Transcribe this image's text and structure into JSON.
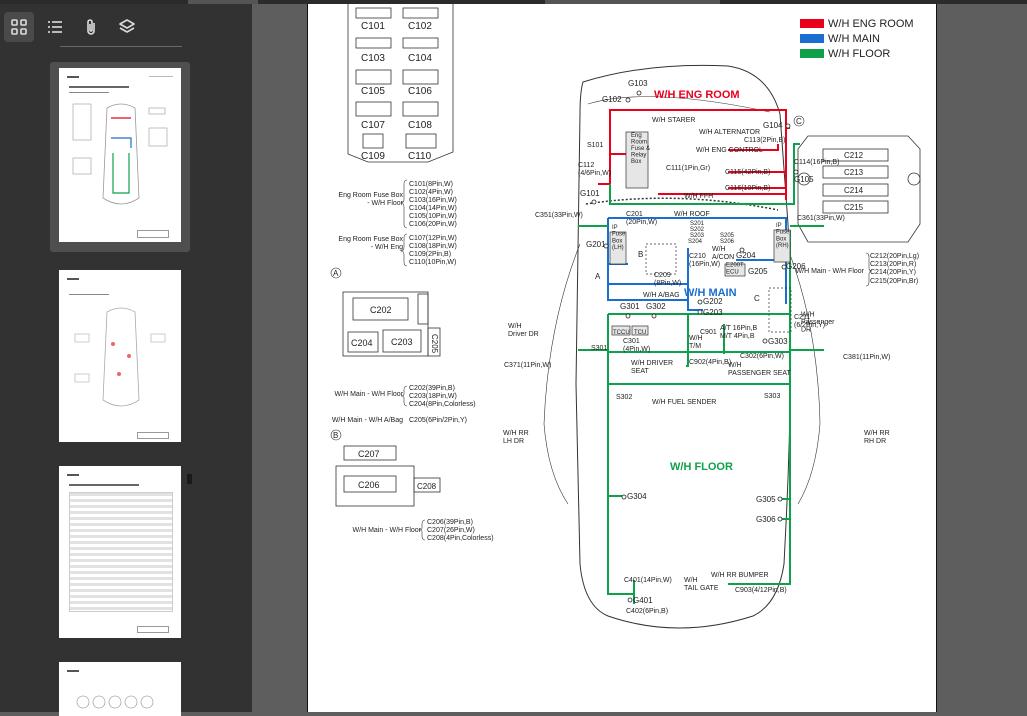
{
  "legend": [
    {
      "label": "W/H ENG ROOM",
      "color": "#e8001c"
    },
    {
      "label": "W/H MAIN",
      "color": "#1a6ecf"
    },
    {
      "label": "W/H FLOOR",
      "color": "#0fa14a"
    }
  ],
  "colors": {
    "eng": "#e8001c",
    "main": "#1a6ecf",
    "floor": "#0fa14a"
  },
  "sidebar": {
    "tools": [
      {
        "name": "thumbnails",
        "icon": "grid-icon"
      },
      {
        "name": "outline",
        "icon": "list-icon"
      },
      {
        "name": "attachments",
        "icon": "paperclip-icon"
      },
      {
        "name": "layers",
        "icon": "layers-icon"
      }
    ]
  },
  "diagram": {
    "zone_titles": {
      "eng": "W/H ENG ROOM",
      "main": "W/H MAIN",
      "floor": "W/H FLOOR"
    },
    "connector_box": [
      "C101",
      "C102",
      "C103",
      "C104",
      "C105",
      "C106",
      "C107",
      "C108",
      "C109",
      "C110"
    ],
    "fuse_box_eng_title": "Eng Room Fuse Box\n- W/H Floor",
    "fuse_box_eng_items": [
      "C101(8Pin,W)",
      "C102(4Pin,W)",
      "C103(16Pin,W)",
      "C104(14Pin,W)",
      "C105(10Pin,W)",
      "C106(20Pin,W)"
    ],
    "fuse_box_eng2_title": "Eng Room Fuse Box\n- W/H Eng",
    "fuse_box_eng2_items": [
      "C107(12Pin,W)",
      "C108(18Pin,W)",
      "C109(2Pin,B)",
      "C110(10Pin,W)"
    ],
    "detail_a": {
      "mark": "A",
      "c202": "C202",
      "c204": "C204",
      "c203": "C203",
      "c205": "C205"
    },
    "detail_b": {
      "mark": "B",
      "c207": "C207",
      "c206": "C206",
      "c208": "C208"
    },
    "detail_c": {
      "mark": "C",
      "c212": "C212",
      "c213": "C213",
      "c214": "C214",
      "c215": "C215"
    },
    "wh_main_floor_left": "W/H Main - W/H Floor",
    "left_a_items": [
      "C202(39Pin,B)",
      "C203(18Pin,W)",
      "C204(8Pin,Colorless)"
    ],
    "wh_main_abag": "W/H Main - W/H A/Bag",
    "c205_label": "C205(6Pin/2Pin,Y)",
    "wh_main_floor_b": "W/H Main - W/H Floor",
    "left_b_items": [
      "C206(39Pin,B)",
      "C207(26Pin,W)",
      "C208(4Pin,Colorless)"
    ],
    "right_c_title": "W/H Main - W/H Floor",
    "right_c_items": [
      "C212(20Pin,Lg)",
      "C213(20Pin,R)",
      "C214(20Pin,Y)",
      "C215(20Pin,Br)"
    ],
    "labels": {
      "g103": "G103",
      "g102": "G102",
      "ws": "W/H STARER",
      "s101": "S101",
      "erfb": "Eng\nRoom\nFuse &\nRelay\nBox",
      "c112": "C112\n(4/6Pin,W)",
      "c111": "C111(1Pin,Gr)",
      "g101": "G101",
      "g104": "G104",
      "wha": "W/H ALTERNATOR",
      "c113": "C113(2Pin,B)",
      "whec": "W/H ENG CONTROL",
      "c114": "C114(16Pin,B)",
      "c115": "C115(42Pin,B)",
      "g105": "G105",
      "c116": "C116(10Pin,B)",
      "whffh": "W/H FFH",
      "c351": "C351(33Pin,W)",
      "c201": "C201\n(20Pin,W)",
      "whroof": "W/H ROOF",
      "s201": "S201",
      "s202": "S202",
      "s203": "S203",
      "s204": "S204",
      "s205": "S205",
      "s206": "S206",
      "c361": "C361(33Pin,W)",
      "g201": "G201",
      "ipl": "IP\nFuse\nBox\n(LH)",
      "ipr": "IP\nFuse\nBox\n(RH)",
      "mb": "B",
      "whacon": "W/H\nA/CON",
      "c210": "C210\n(16Pin,W)",
      "g204": "G204",
      "ecu": "E200T\nECU",
      "g205": "G205",
      "g206": "G206",
      "c209": "C209\n(8Pin,W)",
      "whbag": "W/H A/BAG",
      "ma": "A",
      "g202": "G202",
      "g203": "G203",
      "mc": "C",
      "c211": "C211\n(6/2Pin,Y)",
      "g301": "G301",
      "g302": "G302",
      "tccu": "TCCU",
      "tcu": "TCU",
      "c901": "C901",
      "at": "A/T 16Pin,B",
      "mt": "M/T 4Pin,B",
      "g303": "G303",
      "whdr": "W/H\nDriver DR",
      "whpdr": "W/H\nPassenger\nDR",
      "s301": "S301",
      "c301": "C301\n(4Pin,W)",
      "whtm": "W/H\nT/M",
      "c302": "C302(6Pin,W)",
      "c371": "C371(11Pin,W)",
      "whds": "W/H DRIVER\nSEAT",
      "c902": "C902(4Pin,B)",
      "whps": "W/H\nPASSENGER SEAT",
      "c381": "C381(11Pin,W)",
      "s302": "S302",
      "s303": "S303",
      "whfs": "W/H FUEL SENDER",
      "whrrl": "W/H RR\nLH DR",
      "whrrr": "W/H RR\nRH DR",
      "g304": "G304",
      "g305": "G305",
      "g306": "G306",
      "whrrb": "W/H RR BUMPER",
      "c401": "C401(14Pin,W)",
      "whtg": "W/H\nTAIL GATE",
      "c903": "C903(4/12Pin,B)",
      "g401": "G401",
      "c402": "C402(6Pin,B)"
    }
  }
}
